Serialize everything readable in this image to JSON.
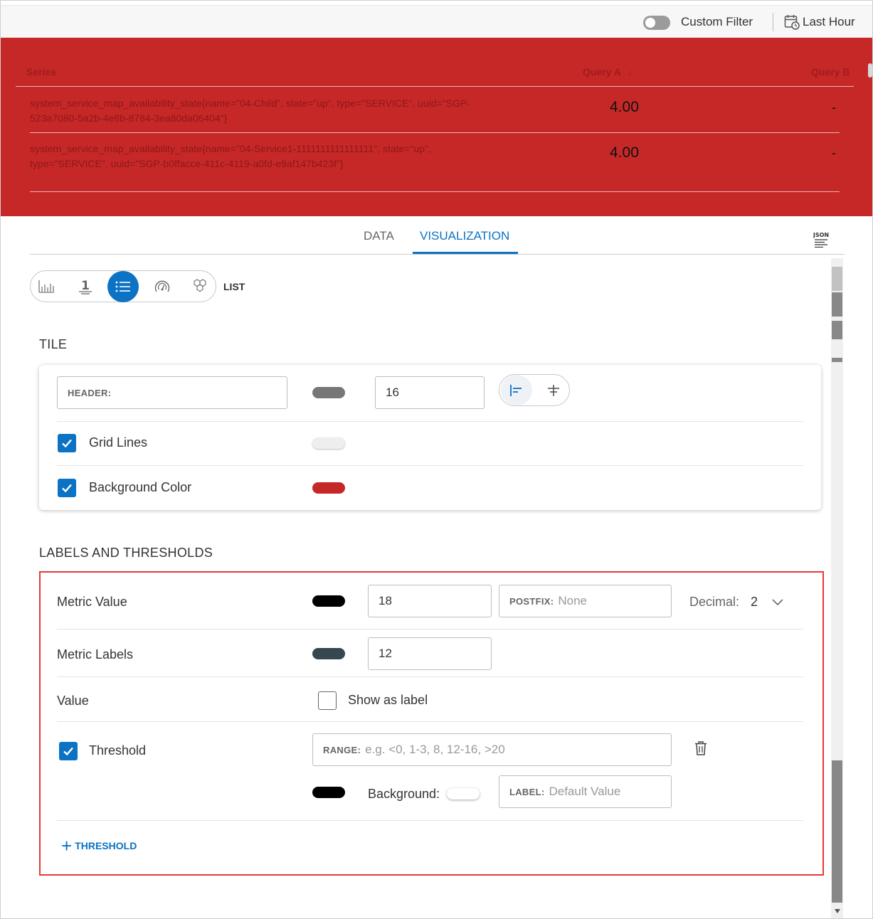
{
  "topbar": {
    "custom_filter_label": "Custom Filter",
    "time_range_label": "Last Hour",
    "custom_filter_on": false
  },
  "preview": {
    "background_color": "#c62828",
    "columns": [
      "Series",
      "Query A",
      "Query B"
    ],
    "sort_indicator": "↓",
    "rows": [
      {
        "series": "system_service_map_availability_state{name=\"04-Child\", state=\"up\", type=\"SERVICE\", uuid=\"SGP-523a7080-5a2b-4e8b-8784-3ea80da06404\"}",
        "query_a": "4.00",
        "query_b": "-"
      },
      {
        "series": "system_service_map_availability_state{name=\"04-Service1-1111111111111111\", state=\"up\", type=\"SERVICE\", uuid=\"SGP-b0ffacce-411c-4119-a0fd-e9af147b423f\"}",
        "query_a": "4.00",
        "query_b": "-"
      }
    ]
  },
  "tabs": {
    "data": "DATA",
    "visualization": "VISUALIZATION",
    "json_icon": "JSON"
  },
  "vis_picker": {
    "icons": [
      "bar-chart-icon",
      "single-value-icon",
      "list-icon",
      "gauge-icon",
      "honeycomb-icon"
    ],
    "selected": "list-icon",
    "selected_label": "LIST"
  },
  "tile": {
    "title": "TILE",
    "header_label": "HEADER:",
    "header_value": "",
    "header_color": "#777777",
    "header_font_size": "16",
    "alignment": "left",
    "grid_lines_label": "Grid Lines",
    "grid_lines_checked": true,
    "grid_lines_color": "#eeeeee",
    "background_label": "Background Color",
    "background_checked": true,
    "background_color": "#c62828"
  },
  "labels": {
    "title": "LABELS AND THRESHOLDS",
    "metric_value_label": "Metric Value",
    "metric_value_color": "#000000",
    "metric_value_size": "18",
    "postfix_label": "POSTFIX:",
    "postfix_placeholder": "None",
    "decimal_label": "Decimal:",
    "decimal_value": "2",
    "metric_labels_label": "Metric Labels",
    "metric_labels_color": "#37474f",
    "metric_labels_size": "12",
    "value_label": "Value",
    "show_as_label": "Show as label",
    "show_as_label_checked": false,
    "threshold_label": "Threshold",
    "threshold_checked": true,
    "range_label": "RANGE:",
    "range_placeholder": "e.g. <0, 1-3, 8, 12-16, >20",
    "threshold_color": "#000000",
    "background_label": "Background:",
    "threshold_bg_color": "#ffffff",
    "label_label": "LABEL:",
    "label_placeholder": "Default Value",
    "add_threshold": "THRESHOLD"
  }
}
